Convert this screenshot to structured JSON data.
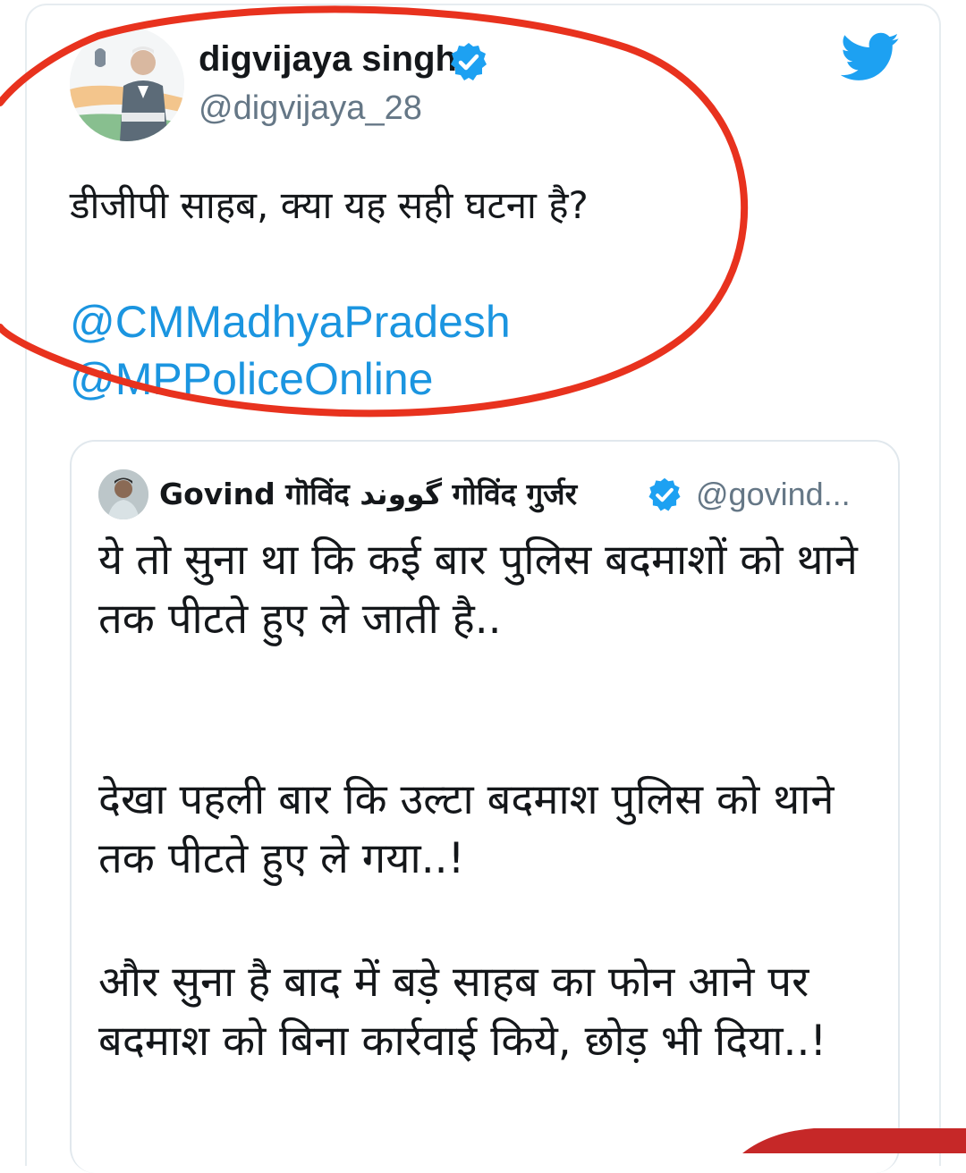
{
  "tweet": {
    "author": {
      "name": "digvijaya singh",
      "handle": "@digvijaya_28"
    },
    "text": "डीजीपी साहब, क्या यह सही घटना है?",
    "mentions": [
      "@CMMadhyaPradesh",
      "@MPPoliceOnline"
    ]
  },
  "quoted_tweet": {
    "author": {
      "name": "Govind गॊविंद گووند गोविंद गुर्जर",
      "handle": "@govind..."
    },
    "paragraphs": [
      "ये तो सुना था कि कई बार पुलिस बदमाशों को थाने तक पीटते हुए ले जाती है..",
      "देखा पहली बार कि उल्टा बदमाश पुलिस को थाने तक पीटते हुए ले गया..!",
      "और सुना है बाद में बड़े साहब का फोन आने पर बदमाश को बिना कार्रवाई किये, छोड़ भी दिया..!"
    ]
  },
  "icons": {
    "verified": "verified-badge-icon",
    "twitter": "twitter-bird-icon"
  },
  "colors": {
    "twitter_blue": "#1da1f2",
    "link": "#1b95e0",
    "handle_gray": "#657786",
    "annotation_red": "#e8321e"
  }
}
